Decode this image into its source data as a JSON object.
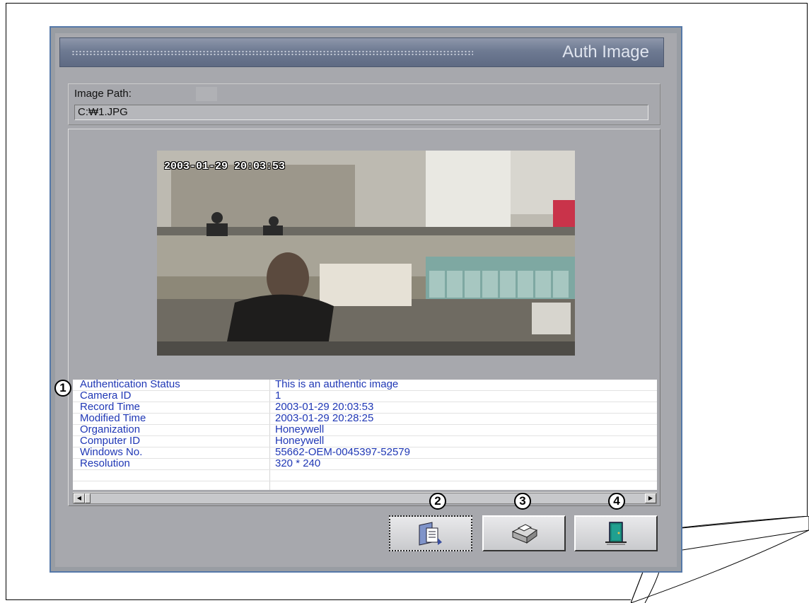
{
  "window": {
    "title": "Auth Image"
  },
  "path": {
    "label": "Image Path:",
    "value": "C:\\1.JPG"
  },
  "photo": {
    "timestamp": "2003-01-29  20:03:53"
  },
  "info": {
    "rows": [
      {
        "key": "Authentication Status",
        "value": "This is an authentic image"
      },
      {
        "key": "Camera ID",
        "value": "1"
      },
      {
        "key": "Record Time",
        "value": "2003-01-29  20:03:53"
      },
      {
        "key": "Modified Time",
        "value": "2003-01-29  20:28:25"
      },
      {
        "key": "Organization",
        "value": "Honeywell"
      },
      {
        "key": "Computer ID",
        "value": "Honeywell"
      },
      {
        "key": "Windows No.",
        "value": "55662-OEM-0045397-52579"
      },
      {
        "key": "Resolution",
        "value": "320 * 240"
      }
    ]
  },
  "callouts": [
    "1",
    "2",
    "3",
    "4"
  ],
  "toolbar": {
    "buttons": [
      {
        "icon": "document-open-icon"
      },
      {
        "icon": "printer-icon"
      },
      {
        "icon": "exit-door-icon"
      }
    ]
  },
  "colors": {
    "info_text": "#1f37b5",
    "window_border": "#5578a8",
    "titlebar": "#6e7a92"
  }
}
